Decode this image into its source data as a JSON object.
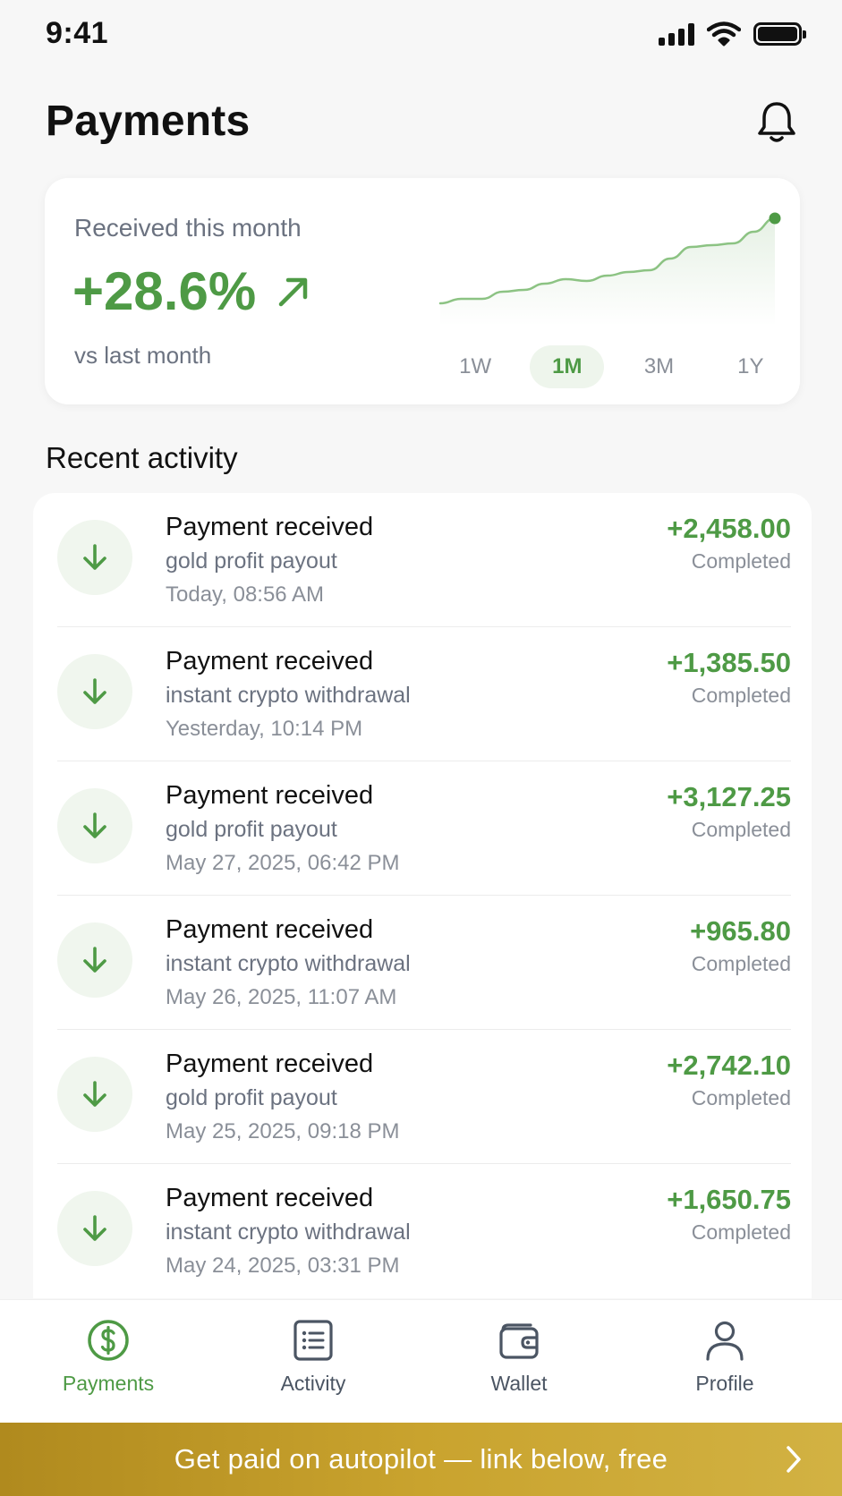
{
  "status_bar": {
    "time": "9:41"
  },
  "header": {
    "title": "Payments"
  },
  "summary": {
    "label": "Received this month",
    "value": "+28.6%",
    "comparison": "vs last month",
    "trend": [
      0.05,
      0.1,
      0.1,
      0.18,
      0.2,
      0.27,
      0.32,
      0.3,
      0.36,
      0.4,
      0.42,
      0.55,
      0.68,
      0.7,
      0.72,
      0.85,
      1.0
    ],
    "ranges": [
      "1W",
      "1M",
      "3M",
      "1Y"
    ],
    "active_range": "1M"
  },
  "recent": {
    "title": "Recent activity",
    "items": [
      {
        "title": "Payment received",
        "description": "gold profit payout",
        "date": "Today, 08:56 AM",
        "amount": "+2,458.00",
        "status": "Completed"
      },
      {
        "title": "Payment received",
        "description": "instant crypto withdrawal",
        "date": "Yesterday, 10:14 PM",
        "amount": "+1,385.50",
        "status": "Completed"
      },
      {
        "title": "Payment received",
        "description": "gold profit payout",
        "date": "May 27, 2025, 06:42 PM",
        "amount": "+3,127.25",
        "status": "Completed"
      },
      {
        "title": "Payment received",
        "description": "instant crypto withdrawal",
        "date": "May 26, 2025, 11:07 AM",
        "amount": "+965.80",
        "status": "Completed"
      },
      {
        "title": "Payment received",
        "description": "gold profit payout",
        "date": "May 25, 2025, 09:18 PM",
        "amount": "+2,742.10",
        "status": "Completed"
      },
      {
        "title": "Payment received",
        "description": "instant crypto withdrawal",
        "date": "May 24, 2025, 03:31 PM",
        "amount": "+1,650.75",
        "status": "Completed"
      }
    ]
  },
  "tabs": [
    {
      "label": "Payments",
      "icon": "dollar-circle-icon",
      "active": true
    },
    {
      "label": "Activity",
      "icon": "list-icon",
      "active": false
    },
    {
      "label": "Wallet",
      "icon": "wallet-icon",
      "active": false
    },
    {
      "label": "Profile",
      "icon": "person-icon",
      "active": false
    }
  ],
  "banner": {
    "text": "Get paid on autopilot — link below, free"
  },
  "colors": {
    "accent": "#4e9a45",
    "banner": "#c9a32e"
  }
}
